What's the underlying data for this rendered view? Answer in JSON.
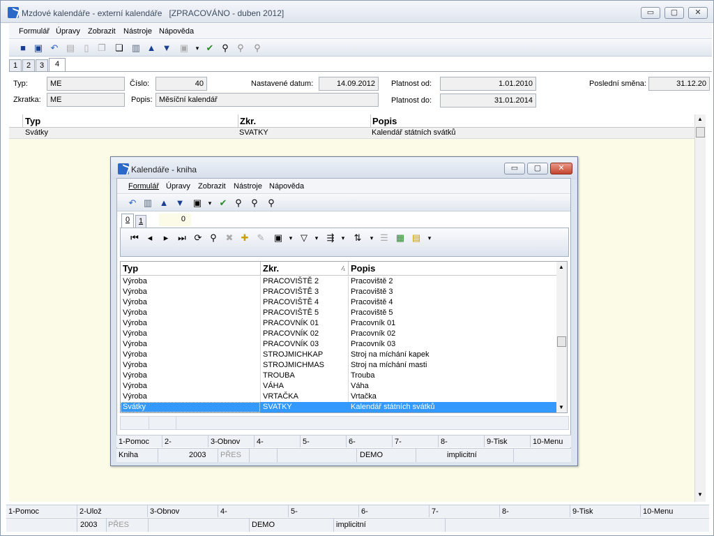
{
  "window": {
    "title": "Mzdové kalendáře - externí kalendáře",
    "status": "[ZPRACOVÁNO - duben 2012]",
    "buttons": [
      "▭",
      "▢",
      "✕"
    ]
  },
  "menu": [
    "Formulář",
    "Úpravy",
    "Zobrazit",
    "Nástroje",
    "Nápověda"
  ],
  "tabs": [
    "1",
    "2",
    "3",
    "4"
  ],
  "form": {
    "typ_label": "Typ:",
    "typ_value": "ME",
    "cislo_label": "Číslo:",
    "cislo_value": "40",
    "datum_label": "Nastavené datum:",
    "datum_value": "14.09.2012",
    "platnost_od_label": "Platnost od:",
    "platnost_od_value": "1.01.2010",
    "posledni_label": "Poslední směna:",
    "posledni_value": "31.12.20",
    "zkratka_label": "Zkratka:",
    "zkratka_value": "ME",
    "popis_label": "Popis:",
    "popis_value": "Měsíční kalendář",
    "platnost_do_label": "Platnost do:",
    "platnost_do_value": "31.01.2014"
  },
  "grid": {
    "columns": [
      "Typ",
      "Zkr.",
      "Popis"
    ],
    "rows": [
      [
        "Svátky",
        "SVATKY",
        "Kalendář státních svátků"
      ]
    ]
  },
  "statusbar": {
    "fkeys": [
      "1-Pomoc",
      "2-Ulož",
      "3-Obnov",
      "4-",
      "5-",
      "6-",
      "7-",
      "8-",
      "9-Tisk",
      "10-Menu"
    ],
    "info": [
      "2003",
      "PŘES",
      "DEMO",
      "implicitní"
    ]
  },
  "dialog": {
    "title": "Kalendáře - kniha",
    "menu": [
      "Formulář",
      "Úpravy",
      "Zobrazit",
      "Nástroje",
      "Nápověda"
    ],
    "tabs": [
      "0",
      "1"
    ],
    "tab_value": "0",
    "columns": [
      "Typ",
      "Zkr.",
      "Popis"
    ],
    "rows": [
      [
        "Výroba",
        "PRACOVIŠTĚ 2",
        "Pracoviště 2"
      ],
      [
        "Výroba",
        "PRACOVIŠTĚ 3",
        "Pracoviště 3"
      ],
      [
        "Výroba",
        "PRACOVIŠTĚ 4",
        "Pracoviště 4"
      ],
      [
        "Výroba",
        "PRACOVIŠTĚ 5",
        "Pracoviště 5"
      ],
      [
        "Výroba",
        "PRACOVNÍK 01",
        "Pracovník 01"
      ],
      [
        "Výroba",
        "PRACOVNÍK 02",
        "Pracovník 02"
      ],
      [
        "Výroba",
        "PRACOVNÍK 03",
        "Pracovník 03"
      ],
      [
        "Výroba",
        "STROJMICHKAP",
        "Stroj na míchání kapek"
      ],
      [
        "Výroba",
        "STROJMICHMAS",
        "Stroj na míchání masti"
      ],
      [
        "Výroba",
        "TROUBA",
        "Trouba"
      ],
      [
        "Výroba",
        "VÁHA",
        "Váha"
      ],
      [
        "Výroba",
        "VRTAČKA",
        "Vrtačka"
      ],
      [
        "Svátky",
        "SVATKY",
        "Kalendář státních svátků"
      ]
    ],
    "fkeys": [
      "1-Pomoc",
      "2-",
      "3-Obnov",
      "4-",
      "5-",
      "6-",
      "7-",
      "8-",
      "9-Tisk",
      "10-Menu"
    ],
    "info": [
      "Kniha",
      "2003",
      "PŘES",
      "DEMO",
      "implicitní"
    ]
  },
  "colors": {
    "selection": "#3399ff",
    "grid_bg": "#fbfbe8"
  }
}
